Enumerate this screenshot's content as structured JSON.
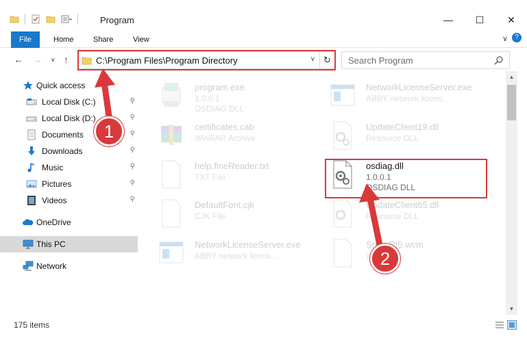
{
  "window": {
    "title": "Program",
    "minimize_glyph": "—",
    "maximize_glyph": "☐",
    "close_glyph": "✕"
  },
  "ribbon": {
    "tabs": [
      "File",
      "Home",
      "Share",
      "View"
    ],
    "expand_glyph": "∨",
    "help_glyph": "?"
  },
  "navigation": {
    "back_glyph": "←",
    "forward_glyph": "→",
    "recent_glyph": "∨",
    "up_glyph": "↑"
  },
  "address_bar": {
    "path": "C:\\Program Files\\Program Directory",
    "dropdown_glyph": "∨",
    "refresh_glyph": "↻"
  },
  "search": {
    "placeholder": "Search Program"
  },
  "sidebar": {
    "items": [
      {
        "label": "Quick access",
        "icon": "star-icon"
      },
      {
        "label": "Local Disk (C:)",
        "icon": "drive-icon",
        "pinned": true
      },
      {
        "label": "Local Disk (D:)",
        "icon": "drive-icon",
        "pinned": true
      },
      {
        "label": "Documents",
        "icon": "documents-icon",
        "pinned": true
      },
      {
        "label": "Downloads",
        "icon": "downloads-icon",
        "pinned": true
      },
      {
        "label": "Music",
        "icon": "music-icon",
        "pinned": true
      },
      {
        "label": "Pictures",
        "icon": "pictures-icon",
        "pinned": true
      },
      {
        "label": "Videos",
        "icon": "videos-icon",
        "pinned": true
      },
      {
        "label": "OneDrive",
        "icon": "onedrive-icon"
      },
      {
        "label": "This PC",
        "icon": "pc-icon",
        "selected": true
      },
      {
        "label": "Network",
        "icon": "network-icon"
      }
    ],
    "pin_glyph": "📌"
  },
  "files": [
    {
      "name": "program.exe",
      "line2": "1.0.0.1",
      "line3": "OSDIAG DLL",
      "icon": "program-exe-icon"
    },
    {
      "name": "NetworkLicenseServer.exe",
      "line2": "ABBY network licens...",
      "line3": "",
      "icon": "app-window-icon"
    },
    {
      "name": "certificates.cab",
      "line2": "WinRAR Archive",
      "line3": "",
      "icon": "winrar-icon"
    },
    {
      "name": "UpdateClient19.dll",
      "line2": "Resource DLL",
      "line3": "",
      "icon": "dll-gear-icon"
    },
    {
      "name": "help.fineReader.txt",
      "line2": "TXT File",
      "line3": "",
      "icon": "text-file-icon"
    },
    {
      "name": "osdiag.dll",
      "line2": "1.0.0.1",
      "line3": "OSDIAG DLL",
      "icon": "dll-gear-icon"
    },
    {
      "name": "DefaultFont.cjk",
      "line2": "CJK File",
      "line3": "",
      "icon": "blank-file-icon"
    },
    {
      "name": "UpdateClient65.dll",
      "line2": "Resource DLL",
      "line3": "",
      "icon": "dll-gear-icon"
    },
    {
      "name": "NetworkLicenseServer.exe",
      "line2": "ABBY network licens...",
      "line3": "",
      "icon": "app-window-icon"
    },
    {
      "name": "Snd...PI5.wcm",
      "line2": "W...",
      "line3": "",
      "icon": "blank-file-icon"
    }
  ],
  "status": {
    "item_count": "175 items"
  },
  "annotations": {
    "step1": "1",
    "step2": "2",
    "color": "#d9393b"
  },
  "colors": {
    "accent": "#1979ca",
    "selection": "#d9d9d9",
    "highlight_red": "#d9393b"
  }
}
